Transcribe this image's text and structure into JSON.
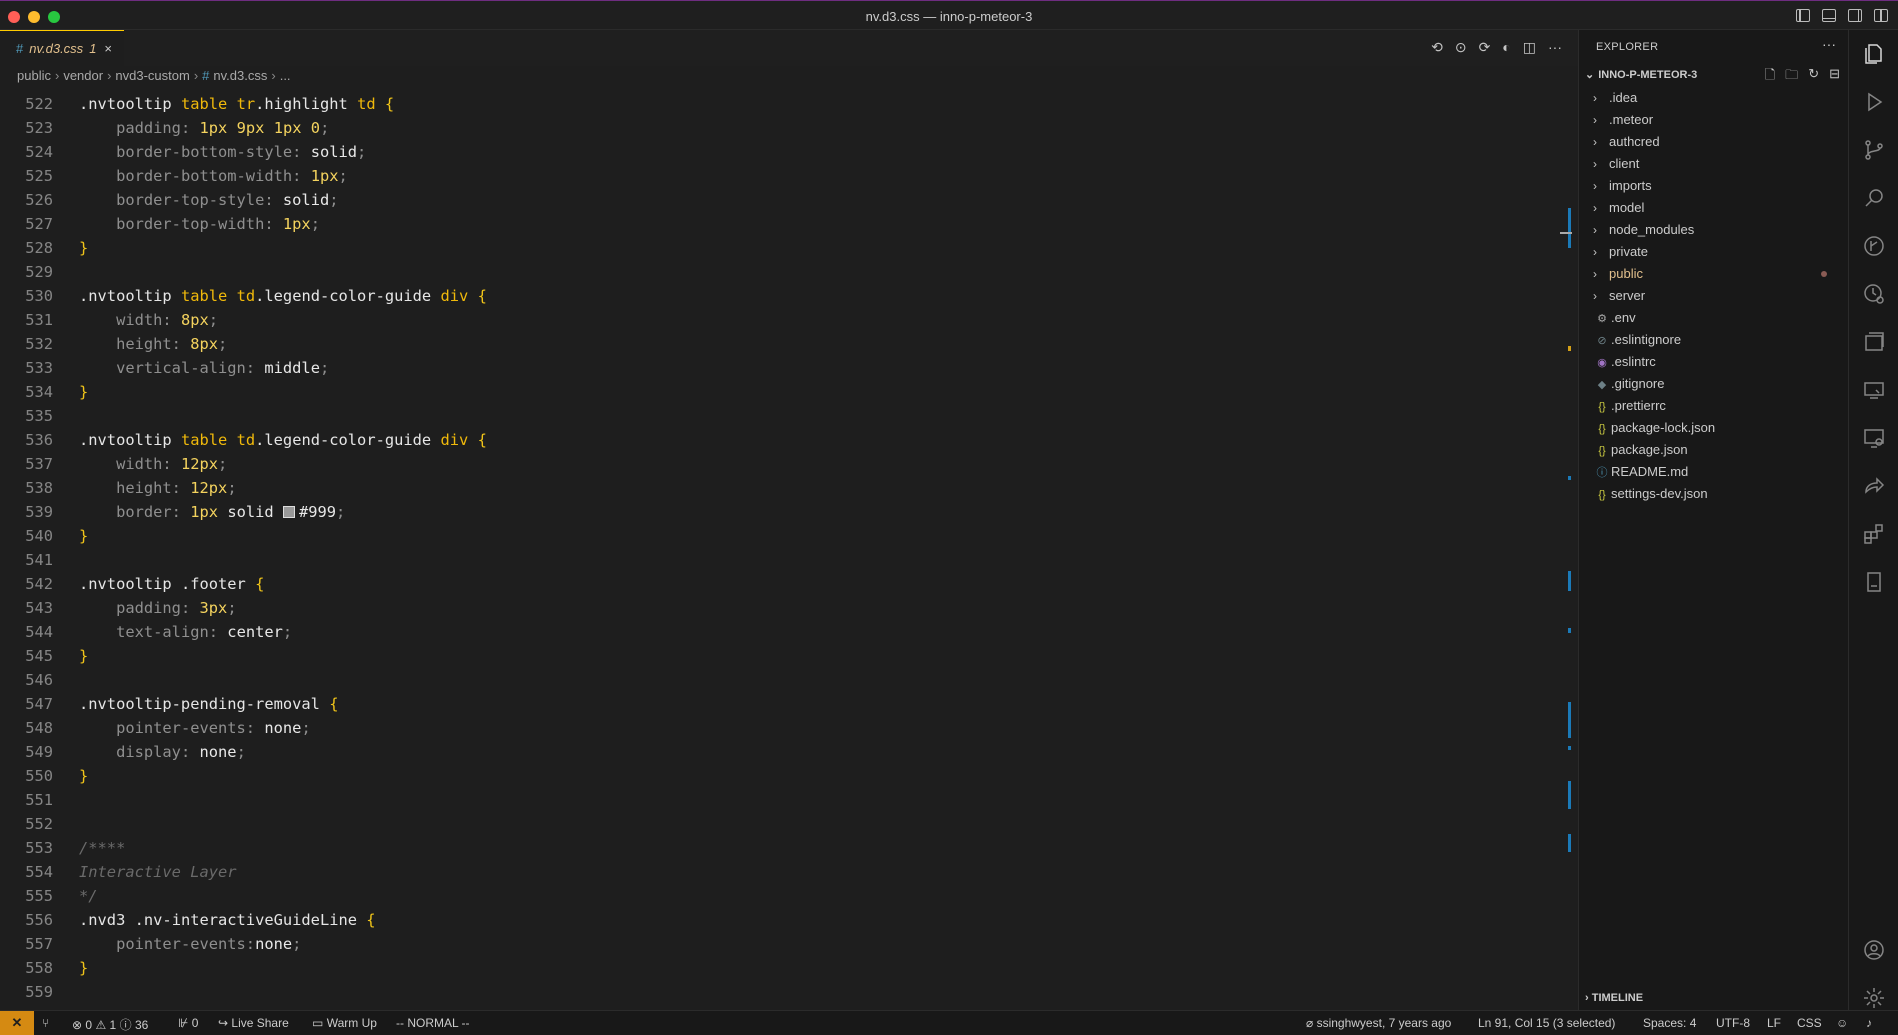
{
  "window": {
    "title": "nv.d3.css — inno-p-meteor-3"
  },
  "tab": {
    "hash": "#",
    "name": "nv.d3.css",
    "count": "1",
    "close": "×"
  },
  "editor_actions": [
    "go-back",
    "go-forward",
    "split",
    "more"
  ],
  "breadcrumb": {
    "parts": [
      "public",
      "vendor",
      "nvd3-custom"
    ],
    "hash": "#",
    "file": "nv.d3.css",
    "ellipsis": "..."
  },
  "code": {
    "lines": [
      {
        "n": "522"
      },
      {
        "n": "523"
      },
      {
        "n": "524"
      },
      {
        "n": "525"
      },
      {
        "n": "526"
      },
      {
        "n": "527"
      },
      {
        "n": "528"
      },
      {
        "n": "529"
      },
      {
        "n": "530"
      },
      {
        "n": "531"
      },
      {
        "n": "532"
      },
      {
        "n": "533"
      },
      {
        "n": "534"
      },
      {
        "n": "535"
      },
      {
        "n": "536"
      },
      {
        "n": "537"
      },
      {
        "n": "538"
      },
      {
        "n": "539"
      },
      {
        "n": "540"
      },
      {
        "n": "541"
      },
      {
        "n": "542"
      },
      {
        "n": "543"
      },
      {
        "n": "544"
      },
      {
        "n": "545"
      },
      {
        "n": "546"
      },
      {
        "n": "547"
      },
      {
        "n": "548"
      },
      {
        "n": "549"
      },
      {
        "n": "550"
      },
      {
        "n": "551"
      },
      {
        "n": "552"
      },
      {
        "n": "553"
      },
      {
        "n": "554"
      },
      {
        "n": "555"
      },
      {
        "n": "556"
      },
      {
        "n": "557"
      },
      {
        "n": "558"
      },
      {
        "n": "559"
      }
    ],
    "t": {
      "nvtooltip": ".nvtooltip",
      "table": "table",
      "tr": "tr",
      "highlight": ".highlight",
      "td": "td",
      "legend_guide": ".legend-color-guide",
      "div": "div",
      "footer": ".footer",
      "pending": ".nvtooltip-pending-removal",
      "nvd3": ".nvd3",
      "guideline": ".nv-interactiveGuideLine",
      "open": "{",
      "close": "}",
      "padding": "padding:",
      "bbs": "border-bottom-style:",
      "bbw": "border-bottom-width:",
      "bts": "border-top-style:",
      "btw": "border-top-width:",
      "width": "width:",
      "height": "height:",
      "valign": "vertical-align:",
      "border": "border:",
      "textalign": "text-align:",
      "pe": "pointer-events:",
      "display": "display:",
      "pe_nospace": "pointer-events:",
      "v_1px": "1px",
      "v_9px": "9px",
      "v_0": "0",
      "v_solid": "solid",
      "v_8px": "8px",
      "v_middle": "middle",
      "v_12px": "12px",
      "v_999": "#999",
      "v_3px": "3px",
      "v_center": "center",
      "v_none": "none",
      "semi": ";",
      "c_open": "/****",
      "c_body": "Interactive Layer",
      "c_close": "*/"
    }
  },
  "explorer": {
    "title": "EXPLORER",
    "more": "···",
    "root": "INNO-P-METEOR-3",
    "folders": [
      ".idea",
      ".meteor",
      "authcred",
      "client",
      "imports",
      "model",
      "node_modules",
      "private",
      "public",
      "server"
    ],
    "files": [
      {
        "name": ".env",
        "icon": "gear-icon"
      },
      {
        "name": ".eslintignore",
        "icon": "ignore-icon"
      },
      {
        "name": ".eslintrc",
        "icon": "eslint-icon"
      },
      {
        "name": ".gitignore",
        "icon": "git-icon"
      },
      {
        "name": ".prettierrc",
        "icon": "json-icon"
      },
      {
        "name": "package-lock.json",
        "icon": "json-icon"
      },
      {
        "name": "package.json",
        "icon": "json-icon"
      },
      {
        "name": "README.md",
        "icon": "info-icon"
      },
      {
        "name": "settings-dev.json",
        "icon": "json-icon"
      }
    ],
    "timeline": "TIMELINE"
  },
  "status": {
    "remote": "✕",
    "errors": "0",
    "warnings": "1",
    "infos": "36",
    "ports": "0",
    "live_share": "Live Share",
    "warm_up": "Warm Up",
    "mode": "-- NORMAL --",
    "blame": "ssinghwyest, 7 years ago",
    "position": "Ln 91, Col 15 (3 selected)",
    "spaces": "Spaces: 4",
    "encoding": "UTF-8",
    "eol": "LF",
    "language": "CSS"
  },
  "colors": {
    "accent": "#d58a12",
    "modified": "#e2c08d",
    "selector_tag": "#f0b90b",
    "number": "#f4d35e"
  }
}
